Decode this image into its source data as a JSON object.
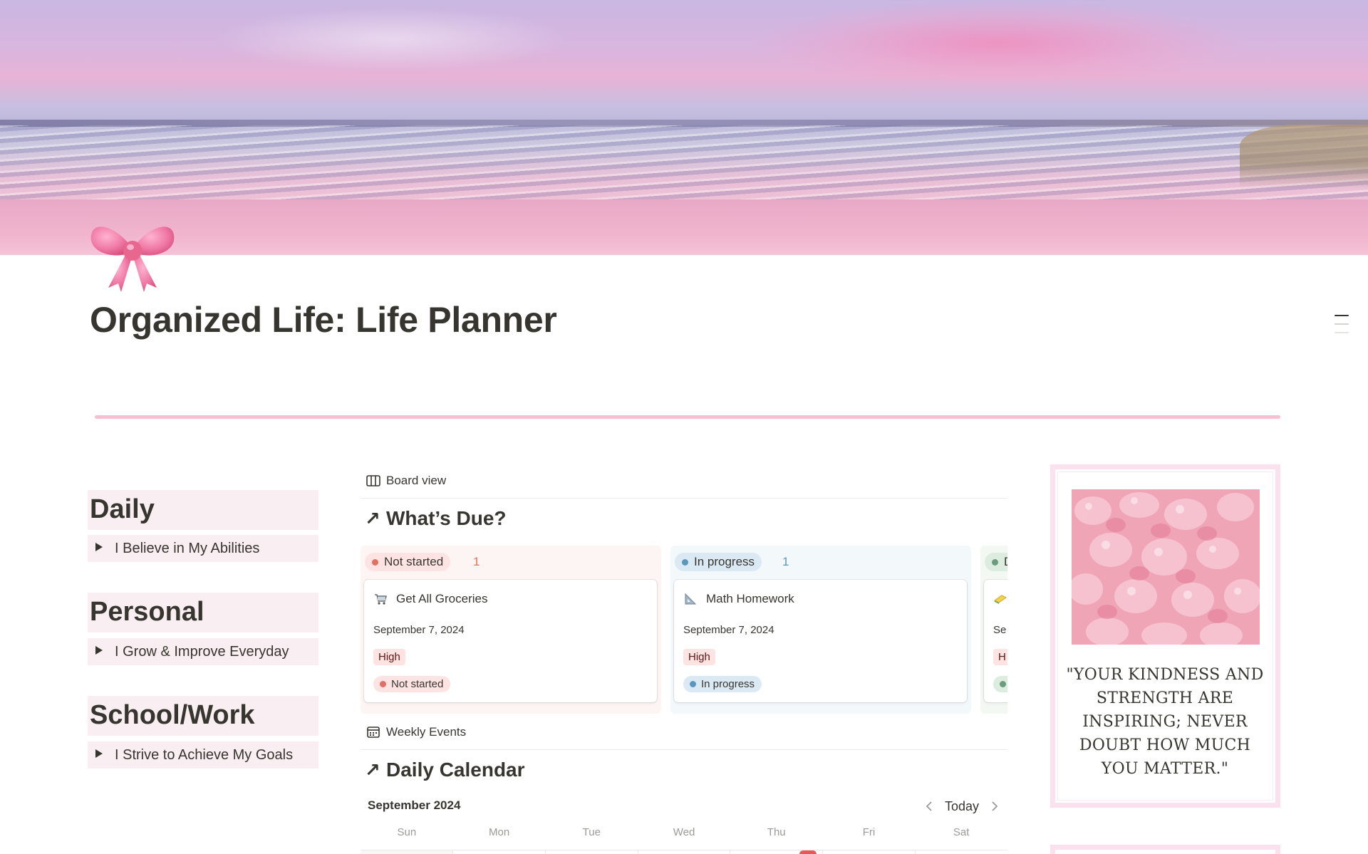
{
  "page": {
    "title": "Organized Life: Life Planner",
    "icon": "bow-icon"
  },
  "colors": {
    "accent_pink": "#f6bfd2",
    "section_bg": "#f9eff2",
    "not_started_dot": "#e16f64",
    "in_progress_dot": "#5b97bd",
    "done_dot": "#6c9b7d",
    "priority_high_bg": "#fde4e2"
  },
  "sidebar": {
    "sections": [
      {
        "title": "Daily",
        "toggle": "I Believe in My Abilities"
      },
      {
        "title": "Personal",
        "toggle": "I Grow & Improve Everyday"
      },
      {
        "title": "School/Work",
        "toggle": "I Strive to Achieve My Goals"
      }
    ]
  },
  "tasks_db": {
    "view_label": "Board view",
    "title": "What’s Due?",
    "columns": [
      {
        "status": "Not started",
        "count": "1",
        "card": {
          "icon": "shopping-cart-icon",
          "title": "Get All Groceries",
          "date": "September 7, 2024",
          "priority": "High",
          "status": "Not started"
        }
      },
      {
        "status": "In progress",
        "count": "1",
        "card": {
          "icon": "triangle-ruler-icon",
          "title": "Math Homework",
          "date": "September 7, 2024",
          "priority": "High",
          "status": "In progress"
        }
      },
      {
        "status": "D",
        "card": {
          "icon": "sponge-icon",
          "date": "Se",
          "priority": "H"
        }
      }
    ]
  },
  "calendar_db": {
    "view_label": "Weekly Events",
    "title": "Daily Calendar",
    "month": "September 2024",
    "today_label": "Today",
    "weekdays": [
      "Sun",
      "Mon",
      "Tue",
      "Wed",
      "Thu",
      "Fri",
      "Sat"
    ]
  },
  "quote": {
    "text": "\"YOUR KINDNESS AND STRENGTH ARE INSPIRING; NEVER DOUBT HOW MUCH YOU MATTER.\"",
    "image": "pink-gummy-bears-image"
  }
}
